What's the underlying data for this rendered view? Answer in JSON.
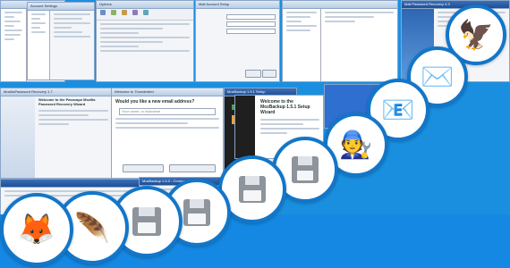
{
  "windows": {
    "w1": {
      "title": ""
    },
    "w2": {
      "title": "Account Settings"
    },
    "w3": {
      "title": "Options"
    },
    "w4": {
      "title": "Mail Account Setup"
    },
    "w5": {
      "title": ""
    },
    "w6": {
      "title": "Mail Password Recovery 4.3"
    },
    "w7": {
      "title": "MozillaPassword Recovery 1.7",
      "heading": "Welcome to the Passcape Mozilla Password Recovery Wizard"
    },
    "w8": {
      "title": "Welcome to Thunderbird",
      "heading": "Would you like a new email address?",
      "field_placeholder": "Your name, or nickname"
    },
    "w9": {
      "title": "MozBackup 1.5.1 Setup",
      "heading": "Welcome to the MozBackup 1.5.1 Setup Wizard"
    },
    "w10": {
      "title": ""
    },
    "w11": {
      "title": "MozBackup 1.4.3 - Components selection"
    }
  },
  "colors": {
    "background": "#1a8fe0",
    "ring": "#1276c9"
  },
  "circles": [
    {
      "name": "thunderbird-icon",
      "emoji": "🦅"
    },
    {
      "name": "mail-recycle-icon",
      "emoji": "✉️"
    },
    {
      "name": "mail-rescue-icon",
      "emoji": "📧"
    },
    {
      "name": "rescue-tool-icon",
      "emoji": "🧑‍🔧"
    },
    {
      "name": "floppy-disk-icon-1"
    },
    {
      "name": "floppy-disk-icon-2"
    },
    {
      "name": "floppy-disk-icon-3"
    },
    {
      "name": "floppy-disk-icon-4"
    },
    {
      "name": "quill-paper-icon",
      "emoji": "🪶"
    },
    {
      "name": "firefox-backup-icon",
      "emoji": "🦊"
    }
  ]
}
